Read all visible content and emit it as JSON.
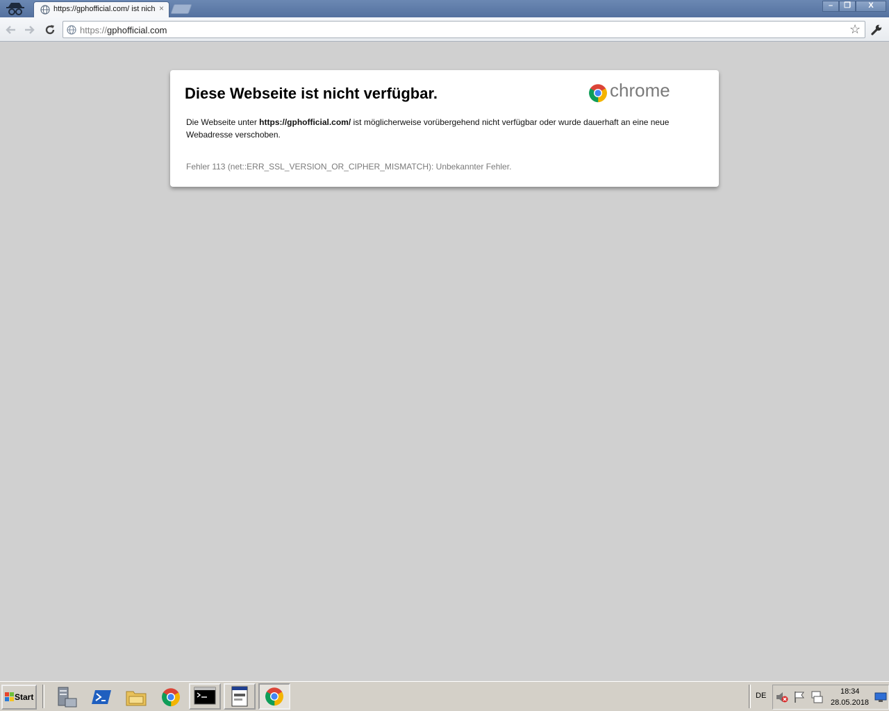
{
  "browser": {
    "tab_title": "https://gphofficial.com/ ist nicht verfügbar",
    "tab_close": "×",
    "window_buttons": {
      "minimize": "–",
      "maximize": "❐",
      "close": "X"
    },
    "url_scheme": "https://",
    "url_host": "gphofficial.com",
    "star_glyph": "☆"
  },
  "error_page": {
    "title": "Diese Webseite ist nicht verfügbar.",
    "brand": "chrome",
    "desc_prefix": "Die Webseite unter ",
    "desc_url": "https://gphofficial.com/",
    "desc_suffix": " ist möglicherweise vorübergehend nicht verfügbar oder wurde dauerhaft an eine neue Webadresse verschoben.",
    "error_code": "Fehler 113 (net::ERR_SSL_VERSION_OR_CIPHER_MISMATCH): Unbekannter Fehler."
  },
  "taskbar": {
    "start_label": "Start",
    "language": "DE",
    "time": "18:34",
    "date": "28.05.2018",
    "pinned": [
      "server-manager-icon",
      "powershell-icon",
      "explorer-icon",
      "chrome-icon"
    ],
    "running": [
      "cmd-icon",
      "app-window-icon",
      "chrome-icon"
    ]
  },
  "colors": {
    "titlebar": "#6b88b3",
    "page_background": "#d0d0d0",
    "chrome_red": "#db4437",
    "chrome_green": "#0f9d58",
    "chrome_yellow": "#f4b400",
    "chrome_blue": "#4285f4"
  }
}
